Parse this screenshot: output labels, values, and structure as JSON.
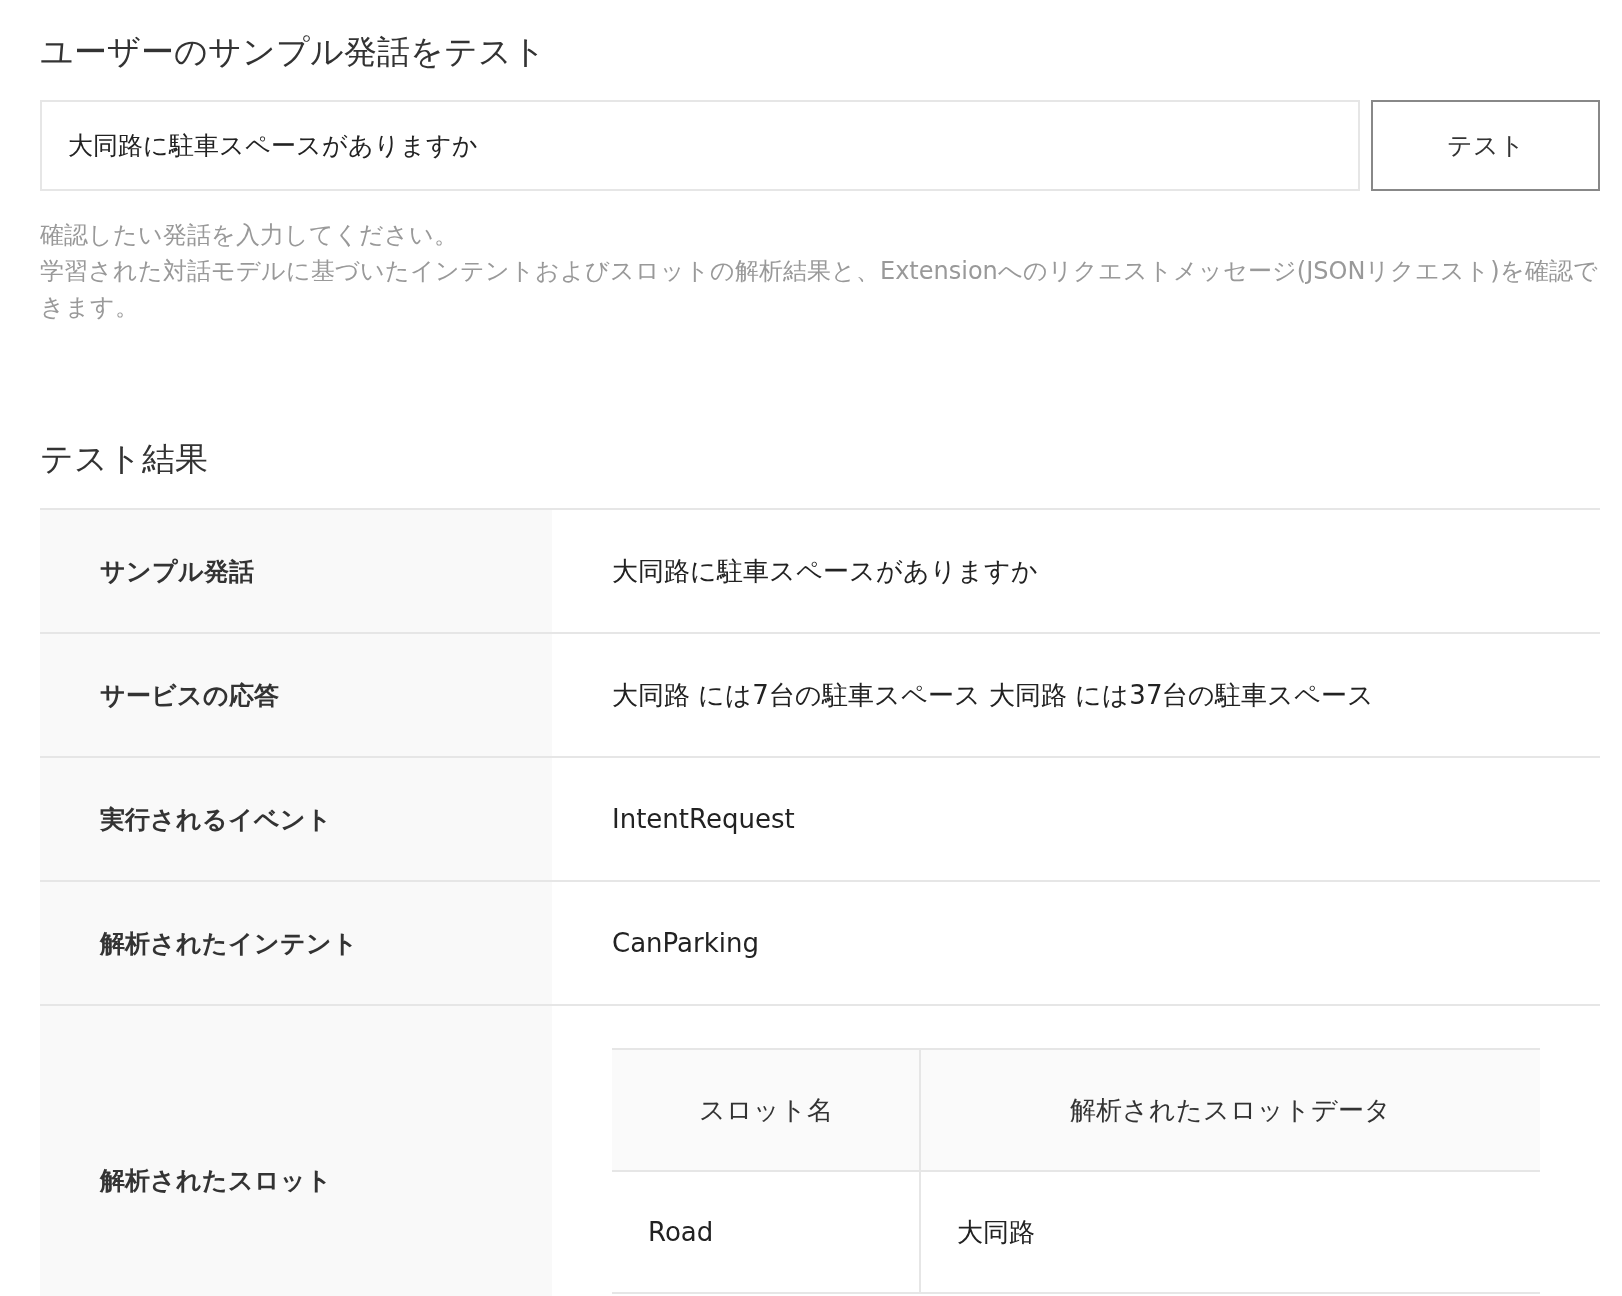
{
  "test_section": {
    "title": "ユーザーのサンプル発話をテスト",
    "input": {
      "value": "大同路に駐車スペースがありますか"
    },
    "button": "テスト",
    "help": [
      "確認したい発話を入力してください。",
      "学習された対話モデルに基づいたインテントおよびスロットの解析結果と、Extensionへのリクエストメッセージ(JSONリクエスト)を確認できます。"
    ]
  },
  "results": {
    "title": "テスト結果",
    "rows": [
      {
        "kind": "text",
        "label": "サンプル発話",
        "value": "大同路に駐車スペースがありますか"
      },
      {
        "kind": "text",
        "label": "サービスの応答",
        "value": "大同路 には7台の駐車スペース 大同路 には37台の駐車スペース"
      },
      {
        "kind": "text",
        "label": "実行されるイベント",
        "value": "IntentRequest"
      },
      {
        "kind": "text",
        "label": "解析されたインテント",
        "value": "CanParking"
      },
      {
        "kind": "slots",
        "label": "解析されたスロット",
        "slot_table": {
          "columns": [
            "スロット名",
            "解析されたスロットデータ"
          ],
          "rows": [
            [
              "Road",
              "大同路"
            ]
          ]
        }
      }
    ]
  }
}
